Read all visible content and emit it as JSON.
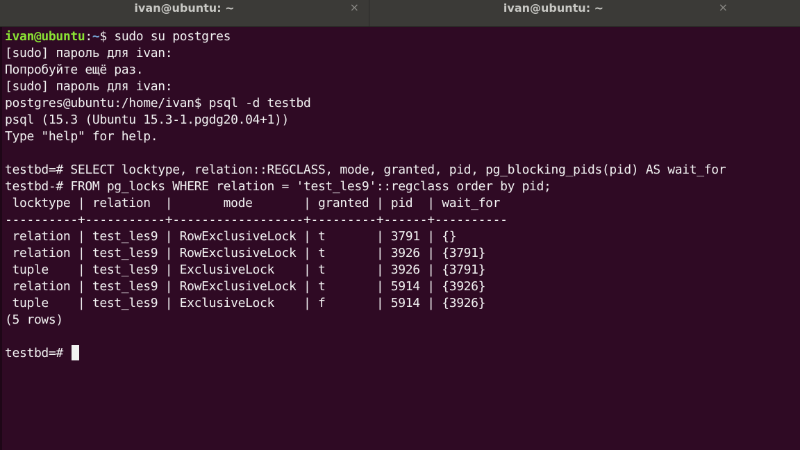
{
  "tabs": [
    {
      "title": "ivan@ubuntu: ~",
      "close": "×"
    },
    {
      "title": "ivan@ubuntu: ~",
      "close": "×"
    }
  ],
  "prompt": {
    "user_host": "ivan@ubuntu",
    "sep": ":",
    "path": "~",
    "symbol": "$ ",
    "command": "sudo su postgres"
  },
  "lines": [
    "[sudo] пароль для ivan:",
    "Попробуйте ещё раз.",
    "[sudo] пароль для ivan:",
    "postgres@ubuntu:/home/ivan$ psql -d testbd",
    "psql (15.3 (Ubuntu 15.3-1.pgdg20.04+1))",
    "Type \"help\" for help.",
    "",
    "testbd=# SELECT locktype, relation::REGCLASS, mode, granted, pid, pg_blocking_pids(pid) AS wait_for",
    "testbd-# FROM pg_locks WHERE relation = 'test_les9'::regclass order by pid;",
    " locktype | relation  |       mode       | granted | pid  | wait_for",
    "----------+-----------+------------------+---------+------+----------",
    " relation | test_les9 | RowExclusiveLock | t       | 3791 | {}",
    " relation | test_les9 | RowExclusiveLock | t       | 3926 | {3791}",
    " tuple    | test_les9 | ExclusiveLock    | t       | 3926 | {3791}",
    " relation | test_les9 | RowExclusiveLock | t       | 5914 | {3926}",
    " tuple    | test_les9 | ExclusiveLock    | f       | 5914 | {3926}",
    "(5 rows)",
    ""
  ],
  "final_prompt": "testbd=# ",
  "colors": {
    "background": "#2f0a24",
    "prompt_user": "#8ae234",
    "prompt_path": "#729fcf",
    "text": "#f2f2f2"
  }
}
